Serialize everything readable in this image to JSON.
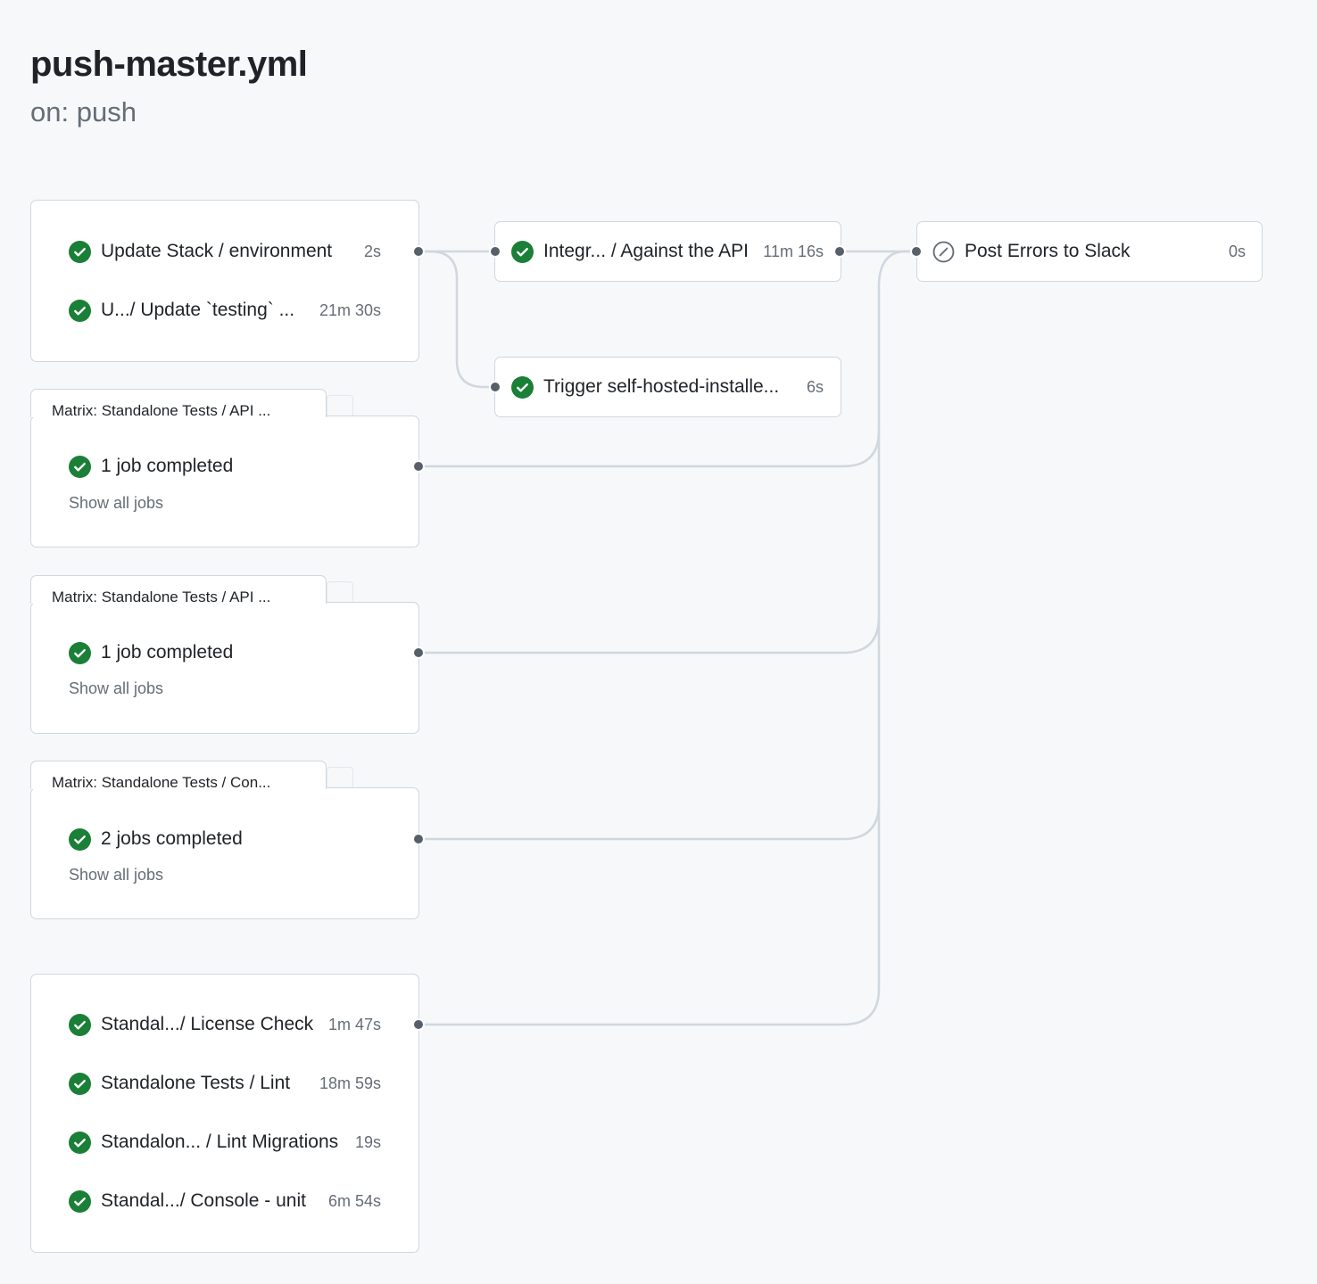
{
  "header": {
    "title": "push-master.yml",
    "trigger": "on: push"
  },
  "colors": {
    "success": "#1a7f37",
    "skipped": "#656d76",
    "edge": "#d0d7de",
    "node": "#57606a"
  },
  "jobs": {
    "update_stack_env": {
      "name": "Update Stack / environment",
      "duration": "2s",
      "status": "success",
      "icon": "check-circle-icon"
    },
    "update_testing": {
      "name": "U.../ Update `testing` ...",
      "duration": "21m 30s",
      "status": "success",
      "icon": "check-circle-icon"
    },
    "integration_api": {
      "name": "Integr... / Against the API",
      "duration": "11m 16s",
      "status": "success",
      "icon": "check-circle-icon"
    },
    "trigger_self_hosted": {
      "name": "Trigger self-hosted-installe...",
      "duration": "6s",
      "status": "success",
      "icon": "check-circle-icon"
    },
    "post_errors_slack": {
      "name": "Post Errors to Slack",
      "duration": "0s",
      "status": "skipped",
      "icon": "skipped-icon"
    },
    "license_check": {
      "name": "Standal.../ License Check",
      "duration": "1m 47s",
      "status": "success",
      "icon": "check-circle-icon"
    },
    "lint": {
      "name": "Standalone Tests / Lint",
      "duration": "18m 59s",
      "status": "success",
      "icon": "check-circle-icon"
    },
    "lint_migrations": {
      "name": "Standalon... / Lint Migrations",
      "duration": "19s",
      "status": "success",
      "icon": "check-circle-icon"
    },
    "console_unit": {
      "name": "Standal.../ Console - unit",
      "duration": "6m 54s",
      "status": "success",
      "icon": "check-circle-icon"
    }
  },
  "matrices": [
    {
      "title": "Matrix: Standalone Tests / API ...",
      "summary": "1 job completed",
      "show_all": "Show all jobs"
    },
    {
      "title": "Matrix: Standalone Tests / API ...",
      "summary": "1 job completed",
      "show_all": "Show all jobs"
    },
    {
      "title": "Matrix: Standalone Tests / Con...",
      "summary": "2 jobs completed",
      "show_all": "Show all jobs"
    }
  ]
}
